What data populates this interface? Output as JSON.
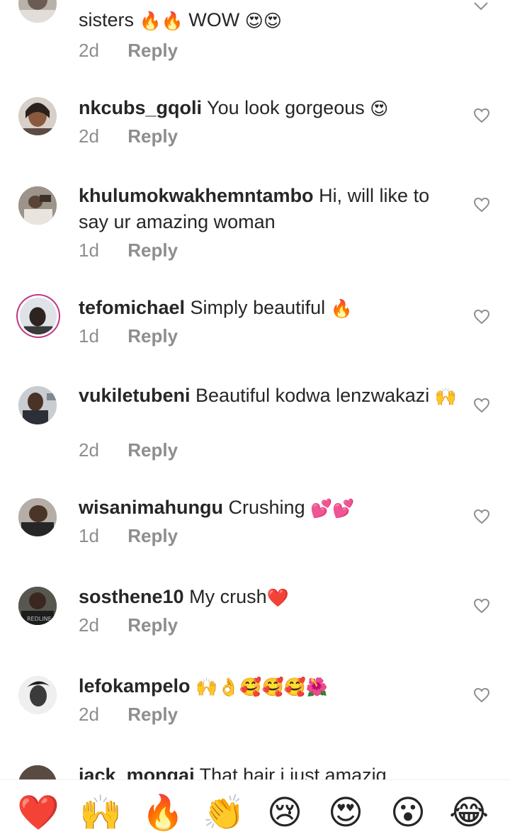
{
  "comments": [
    {
      "user": "",
      "text": "sisters ",
      "emoji": "🔥🔥",
      "text2": " WOW ",
      "emoji2": "😍😍",
      "time": "2d",
      "reply": "Reply"
    },
    {
      "user": "nkcubs_gqoli",
      "text": " You look gorgeous ",
      "emoji": "😍",
      "time": "2d",
      "reply": "Reply"
    },
    {
      "user": "khulumokwakhemntambo",
      "text": " Hi, will like to say ur amazing woman",
      "emoji": "",
      "time": "1d",
      "reply": "Reply"
    },
    {
      "user": "tefomichael",
      "text": " Simply beautiful ",
      "emoji": "🔥",
      "time": "1d",
      "reply": "Reply"
    },
    {
      "user": "vukiletubeni",
      "text": " Beautiful kodwa lenzwakazi ",
      "emoji": "🙌",
      "time": "2d",
      "reply": "Reply"
    },
    {
      "user": "wisanimahungu",
      "text": " Crushing ",
      "emoji": "💕💕",
      "time": "1d",
      "reply": "Reply"
    },
    {
      "user": "sosthene10",
      "text": " My crush",
      "emoji": "❤️",
      "time": "2d",
      "reply": "Reply"
    },
    {
      "user": "lefokampelo",
      "text": " ",
      "emoji": "🙌👌🥰🥰🥰🌺",
      "time": "2d",
      "reply": "Reply"
    },
    {
      "user": "jack_mongai",
      "text": " That hair i just amazig",
      "emoji": "",
      "time": "",
      "reply": ""
    }
  ],
  "quick_reactions": [
    "❤️",
    "🙌",
    "🔥",
    "👏",
    "😢",
    "😍",
    "😮",
    "😂"
  ],
  "icons": {
    "like": "heart-outline-icon",
    "collapse": "chevron-down-icon"
  },
  "colors": {
    "text": "#262626",
    "muted": "#8e8e8e",
    "story_ring": "#c13584"
  }
}
